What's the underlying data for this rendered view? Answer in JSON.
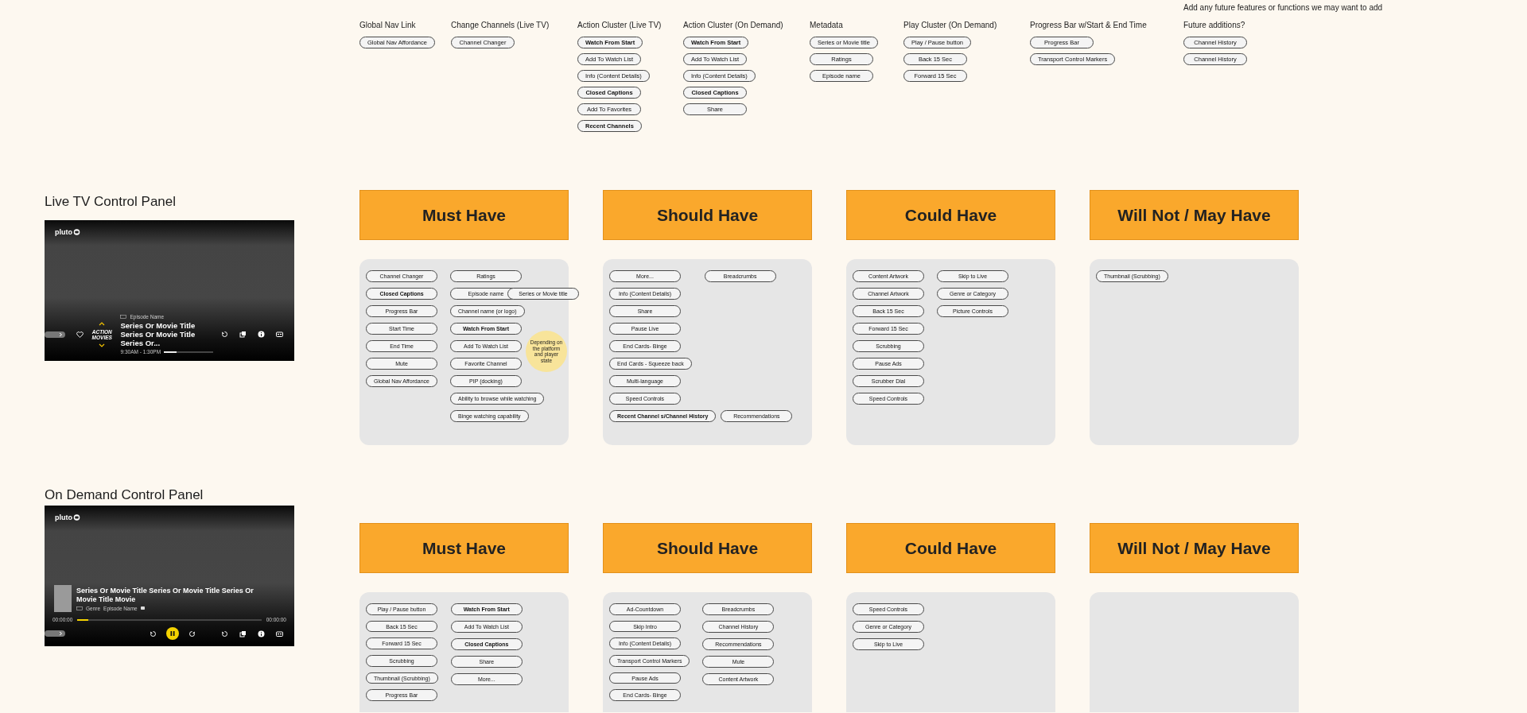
{
  "top_note": "Add any future features or functions we may want to add",
  "categories": [
    {
      "heading": "Global Nav Link",
      "chips": [
        {
          "label": "Global Nav Affordance",
          "bold": false
        }
      ]
    },
    {
      "heading": "Change Channels (Live TV)",
      "chips": [
        {
          "label": "Channel Changer",
          "bold": false
        }
      ]
    },
    {
      "heading": "Action Cluster (Live TV)",
      "chips": [
        {
          "label": "Watch From Start",
          "bold": true
        },
        {
          "label": "Add To Watch List",
          "bold": false
        },
        {
          "label": "Info (Content Details)",
          "bold": false
        },
        {
          "label": "Closed Captions",
          "bold": true
        },
        {
          "label": "Add To Favorites",
          "bold": false
        },
        {
          "label": "Recent Channels",
          "bold": true
        }
      ]
    },
    {
      "heading": "Action Cluster (On Demand)",
      "chips": [
        {
          "label": "Watch From Start",
          "bold": true
        },
        {
          "label": "Add To Watch List",
          "bold": false
        },
        {
          "label": "Info (Content Details)",
          "bold": false
        },
        {
          "label": "Closed Captions",
          "bold": true
        },
        {
          "label": "Share",
          "bold": false
        }
      ]
    },
    {
      "heading": "Metadata",
      "chips": [
        {
          "label": "Series or Movie title",
          "bold": false
        },
        {
          "label": "Ratings",
          "bold": false
        },
        {
          "label": "Episode name",
          "bold": false
        }
      ]
    },
    {
      "heading": "Play Cluster (On Demand)",
      "chips": [
        {
          "label": "Play / Pause button",
          "bold": false
        },
        {
          "label": "Back 15 Sec",
          "bold": false
        },
        {
          "label": "Forward 15 Sec",
          "bold": false
        }
      ]
    },
    {
      "heading": "Progress Bar w/Start & End Time",
      "chips": [
        {
          "label": "Progress Bar",
          "bold": false
        },
        {
          "label": "Transport Control Markers",
          "bold": false
        }
      ]
    },
    {
      "heading": "Future additions?",
      "chips": [
        {
          "label": "Channel History",
          "bold": false
        },
        {
          "label": "Channel History",
          "bold": false
        }
      ]
    }
  ],
  "sections": [
    {
      "title": "Live TV Control Panel",
      "preview": {
        "kind": "live",
        "logo": "pluto",
        "episode": "Episode Name",
        "title": "Series Or Movie Title Series Or Movie Title Series Or...",
        "time": "9:30AM - 1:30PM",
        "channel_logo": "ACTION MOVIES",
        "level": 0.25
      },
      "boards": [
        {
          "heading": "Must Have",
          "note": "Depending on the platform and player state",
          "columns": [
            [
              {
                "kind": "chip",
                "label": "Channel Changer",
                "bold": false
              },
              {
                "kind": "chip",
                "label": "Closed Captions",
                "bold": true
              },
              {
                "kind": "chip",
                "label": "Progress Bar",
                "bold": false
              },
              {
                "kind": "chip",
                "label": "Start Time",
                "bold": false
              },
              {
                "kind": "chip",
                "label": "End Time",
                "bold": false
              },
              {
                "kind": "chip",
                "label": "Mute",
                "bold": false
              },
              {
                "kind": "chip",
                "label": "Global Nav Affordance",
                "bold": false
              }
            ],
            [
              {
                "kind": "chip",
                "label": "Ratings",
                "bold": false
              },
              {
                "kind": "row",
                "chips": [
                  {
                    "label": "Episode name",
                    "bold": false
                  },
                  {
                    "label": "Series or Movie title",
                    "bold": false
                  }
                ]
              },
              {
                "kind": "chip",
                "label": "Channel name (or logo)",
                "bold": false
              },
              {
                "kind": "chip",
                "label": "Watch From Start",
                "bold": true
              },
              {
                "kind": "chip",
                "label": "Add To Watch List",
                "bold": false
              },
              {
                "kind": "chip",
                "label": "Favorite Channel",
                "bold": false
              },
              {
                "kind": "chip",
                "label": "PIP (docking)",
                "bold": false
              },
              {
                "kind": "chip",
                "label": "Ability to browse while watching",
                "bold": false
              },
              {
                "kind": "chip",
                "label": "Binge watching capability",
                "bold": false
              }
            ]
          ]
        },
        {
          "heading": "Should Have",
          "columns": [
            [
              {
                "kind": "chip",
                "label": "More...",
                "bold": false
              },
              {
                "kind": "chip",
                "label": "Info (Content Details)",
                "bold": false
              },
              {
                "kind": "chip",
                "label": "Share",
                "bold": false
              },
              {
                "kind": "chip",
                "label": "Pause Live",
                "bold": false
              },
              {
                "kind": "chip",
                "label": "End Cards- Binge",
                "bold": false
              },
              {
                "kind": "chip",
                "label": "End Cards - Squeeze back",
                "bold": false
              },
              {
                "kind": "chip",
                "label": "Multi-language",
                "bold": false
              },
              {
                "kind": "chip",
                "label": "Speed Controls",
                "bold": false
              },
              {
                "kind": "row",
                "chips": [
                  {
                    "label": "Recent Channel s/Channel History",
                    "bold": true
                  },
                  {
                    "label": "Recommendations",
                    "bold": false
                  }
                ]
              }
            ],
            [
              {
                "kind": "chip",
                "label": "Breadcrumbs",
                "bold": false
              }
            ]
          ]
        },
        {
          "heading": "Could Have",
          "columns": [
            [
              {
                "kind": "chip",
                "label": "Content Artwork",
                "bold": false
              },
              {
                "kind": "chip",
                "label": "Channel Artwork",
                "bold": false
              },
              {
                "kind": "chip",
                "label": "Back 15 Sec",
                "bold": false
              },
              {
                "kind": "chip",
                "label": "Forward 15 Sec",
                "bold": false
              },
              {
                "kind": "chip",
                "label": "Scrubbing",
                "bold": false
              },
              {
                "kind": "chip",
                "label": "Pause Ads",
                "bold": false
              },
              {
                "kind": "chip",
                "label": "Scrubber Dial",
                "bold": false
              },
              {
                "kind": "chip",
                "label": "Speed Controls",
                "bold": false
              }
            ],
            [
              {
                "kind": "chip",
                "label": "Skip to Live",
                "bold": false
              },
              {
                "kind": "chip",
                "label": "Genre or Category",
                "bold": false
              },
              {
                "kind": "chip",
                "label": "Picture Controls",
                "bold": false
              }
            ]
          ]
        },
        {
          "heading": "Will Not / May Have",
          "columns": [
            [
              {
                "kind": "chip",
                "label": "Thumbnail (Scrubbing)",
                "bold": false
              }
            ]
          ]
        }
      ]
    },
    {
      "title": "On Demand Control Panel",
      "preview": {
        "kind": "on_demand",
        "logo": "pluto",
        "title": "Series Or Movie Title Series Or Movie Title Series Or Movie Title Movie",
        "genre": "Genre",
        "episode": "Episode Name",
        "elapsed": "00:00:00",
        "duration": "00:00:00",
        "level": 0.06
      },
      "boards": [
        {
          "heading": "Must Have",
          "columns": [
            [
              {
                "kind": "chip",
                "label": "Play / Pause button",
                "bold": false
              },
              {
                "kind": "chip",
                "label": "Back 15 Sec",
                "bold": false
              },
              {
                "kind": "chip",
                "label": "Forward 15 Sec",
                "bold": false
              },
              {
                "kind": "chip",
                "label": "Scrubbing",
                "bold": false
              },
              {
                "kind": "chip",
                "label": "Thumbnail (Scrubbing)",
                "bold": false
              },
              {
                "kind": "chip",
                "label": "Progress Bar",
                "bold": false
              }
            ],
            [
              {
                "kind": "chip",
                "label": "Watch From Start",
                "bold": true
              },
              {
                "kind": "chip",
                "label": "Add To Watch List",
                "bold": false
              },
              {
                "kind": "chip",
                "label": "Closed Captions",
                "bold": true
              },
              {
                "kind": "chip",
                "label": "Share",
                "bold": false
              },
              {
                "kind": "chip",
                "label": "More...",
                "bold": false
              }
            ]
          ]
        },
        {
          "heading": "Should Have",
          "columns": [
            [
              {
                "kind": "chip",
                "label": "Ad-Countdown",
                "bold": false
              },
              {
                "kind": "chip",
                "label": "Skip Intro",
                "bold": false
              },
              {
                "kind": "chip",
                "label": "Info (Content Details)",
                "bold": false
              },
              {
                "kind": "chip",
                "label": "Transport Control Markers",
                "bold": false
              },
              {
                "kind": "chip",
                "label": "Pause Ads",
                "bold": false
              },
              {
                "kind": "chip",
                "label": "End Cards- Binge",
                "bold": false
              }
            ],
            [
              {
                "kind": "chip",
                "label": "Breadcrumbs",
                "bold": false
              },
              {
                "kind": "chip",
                "label": "Channel History",
                "bold": false
              },
              {
                "kind": "chip",
                "label": "Recommendations",
                "bold": false
              },
              {
                "kind": "chip",
                "label": "Mute",
                "bold": false
              },
              {
                "kind": "chip",
                "label": "Content Artwork",
                "bold": false
              }
            ]
          ]
        },
        {
          "heading": "Could Have",
          "columns": [
            [
              {
                "kind": "chip",
                "label": "Speed Controls",
                "bold": false
              },
              {
                "kind": "chip",
                "label": "Genre or Category",
                "bold": false
              },
              {
                "kind": "chip",
                "label": "Skip to Live",
                "bold": false
              }
            ]
          ]
        },
        {
          "heading": "Will Not / May Have"
        }
      ]
    }
  ]
}
